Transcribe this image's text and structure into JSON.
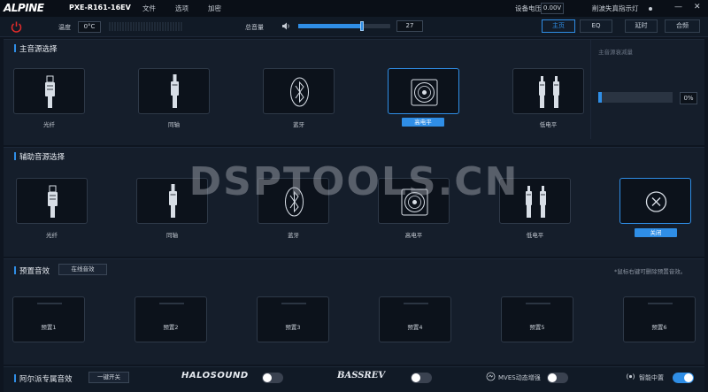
{
  "titlebar": {
    "logo": "ALPINE",
    "model": "PXE-R161-16EV",
    "menu": [
      "文件",
      "选项",
      "加密"
    ],
    "voltage_label": "设备电压",
    "voltage_value": "0.00V",
    "undervoltage_text": "削波失真指示灯",
    "minimize_glyph": "—",
    "close_glyph": "✕"
  },
  "toolbar": {
    "temp_label": "温度",
    "temp_value": "0°C",
    "master_volume_label": "总音量",
    "volume_value": "27",
    "volume_fraction": 0.69,
    "tabs": [
      {
        "label": "主页",
        "active": true
      },
      {
        "label": "EQ",
        "active": false
      },
      {
        "label": "延时",
        "active": false
      },
      {
        "label": "合频",
        "active": false
      }
    ]
  },
  "main_source": {
    "title": "主音源选择",
    "items": [
      {
        "label": "光纤",
        "icon": "fiber-optic-icon",
        "selected": false
      },
      {
        "label": "同轴",
        "icon": "coaxial-icon",
        "selected": false
      },
      {
        "label": "蓝牙",
        "icon": "bluetooth-icon",
        "selected": false
      },
      {
        "label": "高电平",
        "icon": "speaker-icon",
        "selected": true
      },
      {
        "label": "低电平",
        "icon": "rca-icon",
        "selected": false
      }
    ],
    "attenuation_label": "主音源衰减量",
    "attenuation_value": "0%",
    "attenuation_fraction": 0.0
  },
  "aux_source": {
    "title": "辅助音源选择",
    "items": [
      {
        "label": "光纤",
        "icon": "fiber-optic-icon"
      },
      {
        "label": "同轴",
        "icon": "coaxial-icon"
      },
      {
        "label": "蓝牙",
        "icon": "bluetooth-icon"
      },
      {
        "label": "高电平",
        "icon": "speaker-icon"
      },
      {
        "label": "低电平",
        "icon": "rca-icon"
      }
    ],
    "off_label": "关闭",
    "off_selected": true
  },
  "presets": {
    "title": "预置音效",
    "online_button": "在线音效",
    "hint": "*鼠标右键可删除预置音效。",
    "items": [
      "预置1",
      "预置2",
      "预置3",
      "预置4",
      "预置5",
      "预置6"
    ]
  },
  "alpine_effects": {
    "title": "阿尔派专属音效",
    "one_key_button": "一键开关",
    "halosound_logo": "HALOSOUND",
    "halosound_on": false,
    "bassrev_logo": "BASSREV",
    "bassrev_on": false,
    "mves_label": "MVES动态增强",
    "mves_on": false,
    "center_label": "智能中置",
    "center_on": true
  },
  "watermark": "DSPTOOLS.CN",
  "colors": {
    "accent": "#2f8ee6",
    "power": "#e02b2b",
    "background": "#0e1520",
    "panel": "#151e2b"
  }
}
